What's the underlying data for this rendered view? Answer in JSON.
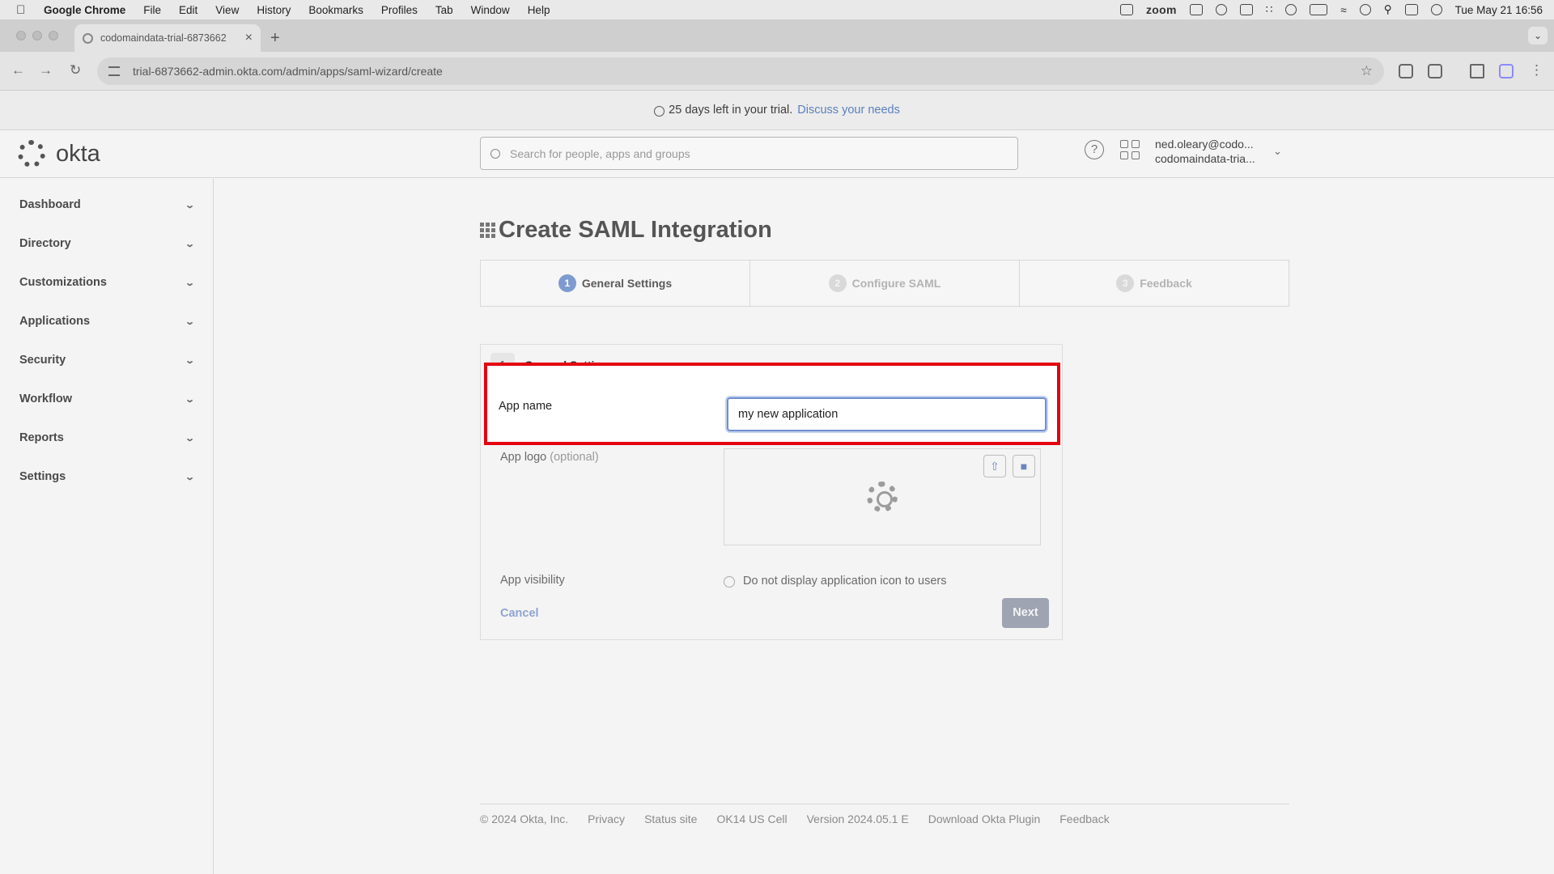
{
  "menubar": {
    "app": "Google Chrome",
    "menus": [
      "File",
      "Edit",
      "View",
      "History",
      "Bookmarks",
      "Profiles",
      "Tab",
      "Window",
      "Help"
    ],
    "zoom_label": "zoom",
    "clock": "Tue May 21  16:56"
  },
  "browser": {
    "tab_title": "codomaindata-trial-6873662",
    "tab_close": "×",
    "new_tab": "+",
    "url": "trial-6873662-admin.okta.com/admin/apps/saml-wizard/create"
  },
  "trial_banner": {
    "text": "25 days left in your trial.",
    "link": "Discuss your needs"
  },
  "header": {
    "logo_text": "okta",
    "search_placeholder": "Search for people, apps and groups",
    "user_email": "ned.oleary@codo...",
    "user_org": "codomaindata-tria..."
  },
  "sidebar": {
    "items": [
      {
        "label": "Dashboard"
      },
      {
        "label": "Directory"
      },
      {
        "label": "Customizations"
      },
      {
        "label": "Applications"
      },
      {
        "label": "Security"
      },
      {
        "label": "Workflow"
      },
      {
        "label": "Reports"
      },
      {
        "label": "Settings"
      }
    ]
  },
  "page": {
    "title": "Create SAML Integration",
    "steps": [
      {
        "num": "1",
        "label": "General Settings",
        "state": "active"
      },
      {
        "num": "2",
        "label": "Configure SAML",
        "state": "inactive"
      },
      {
        "num": "3",
        "label": "Feedback",
        "state": "inactive"
      }
    ]
  },
  "form": {
    "section_number": "1",
    "section_title": "General Settings",
    "app_name_label": "App name",
    "app_name_value": "my new application",
    "app_logo_label": "App logo",
    "app_logo_optional": "(optional)",
    "app_visibility_label": "App visibility",
    "visibility_checkbox_label": "Do not display application icon to users",
    "visibility_checked": false,
    "cancel_label": "Cancel",
    "next_label": "Next"
  },
  "footer": {
    "items": [
      "© 2024 Okta, Inc.",
      "Privacy",
      "Status site",
      "OK14 US Cell",
      "Version 2024.05.1 E",
      "Download Okta Plugin",
      "Feedback"
    ]
  },
  "colors": {
    "highlight_border": "#e3000f",
    "link_blue": "#5a7fbf",
    "active_step": "#7d9bd0"
  }
}
